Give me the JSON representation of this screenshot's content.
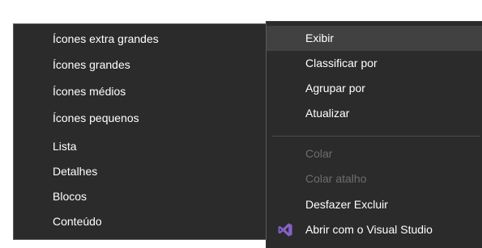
{
  "context_menu": {
    "items": [
      {
        "label": "Exibir",
        "state": "highlighted"
      },
      {
        "label": "Classificar por",
        "state": "normal"
      },
      {
        "label": "Agrupar por",
        "state": "normal"
      },
      {
        "label": "Atualizar",
        "state": "normal"
      },
      {
        "label": "Colar",
        "state": "disabled"
      },
      {
        "label": "Colar atalho",
        "state": "disabled"
      },
      {
        "label": "Desfazer Excluir",
        "state": "normal"
      },
      {
        "label": "Abrir com o Visual Studio",
        "state": "normal",
        "icon": "visual-studio-icon"
      }
    ]
  },
  "view_submenu": {
    "items": [
      {
        "label": "Ícones extra grandes"
      },
      {
        "label": "Ícones grandes"
      },
      {
        "label": "Ícones médios"
      },
      {
        "label": "Ícones pequenos"
      },
      {
        "label": "Lista"
      },
      {
        "label": "Detalhes"
      },
      {
        "label": "Blocos"
      },
      {
        "label": "Conteúdo"
      }
    ]
  },
  "colors": {
    "menu_background": "#2b2b2b",
    "highlight": "#414141",
    "text": "#ffffff",
    "disabled_text": "#6d6d6d",
    "visual_studio_purple": "#8661c5"
  }
}
